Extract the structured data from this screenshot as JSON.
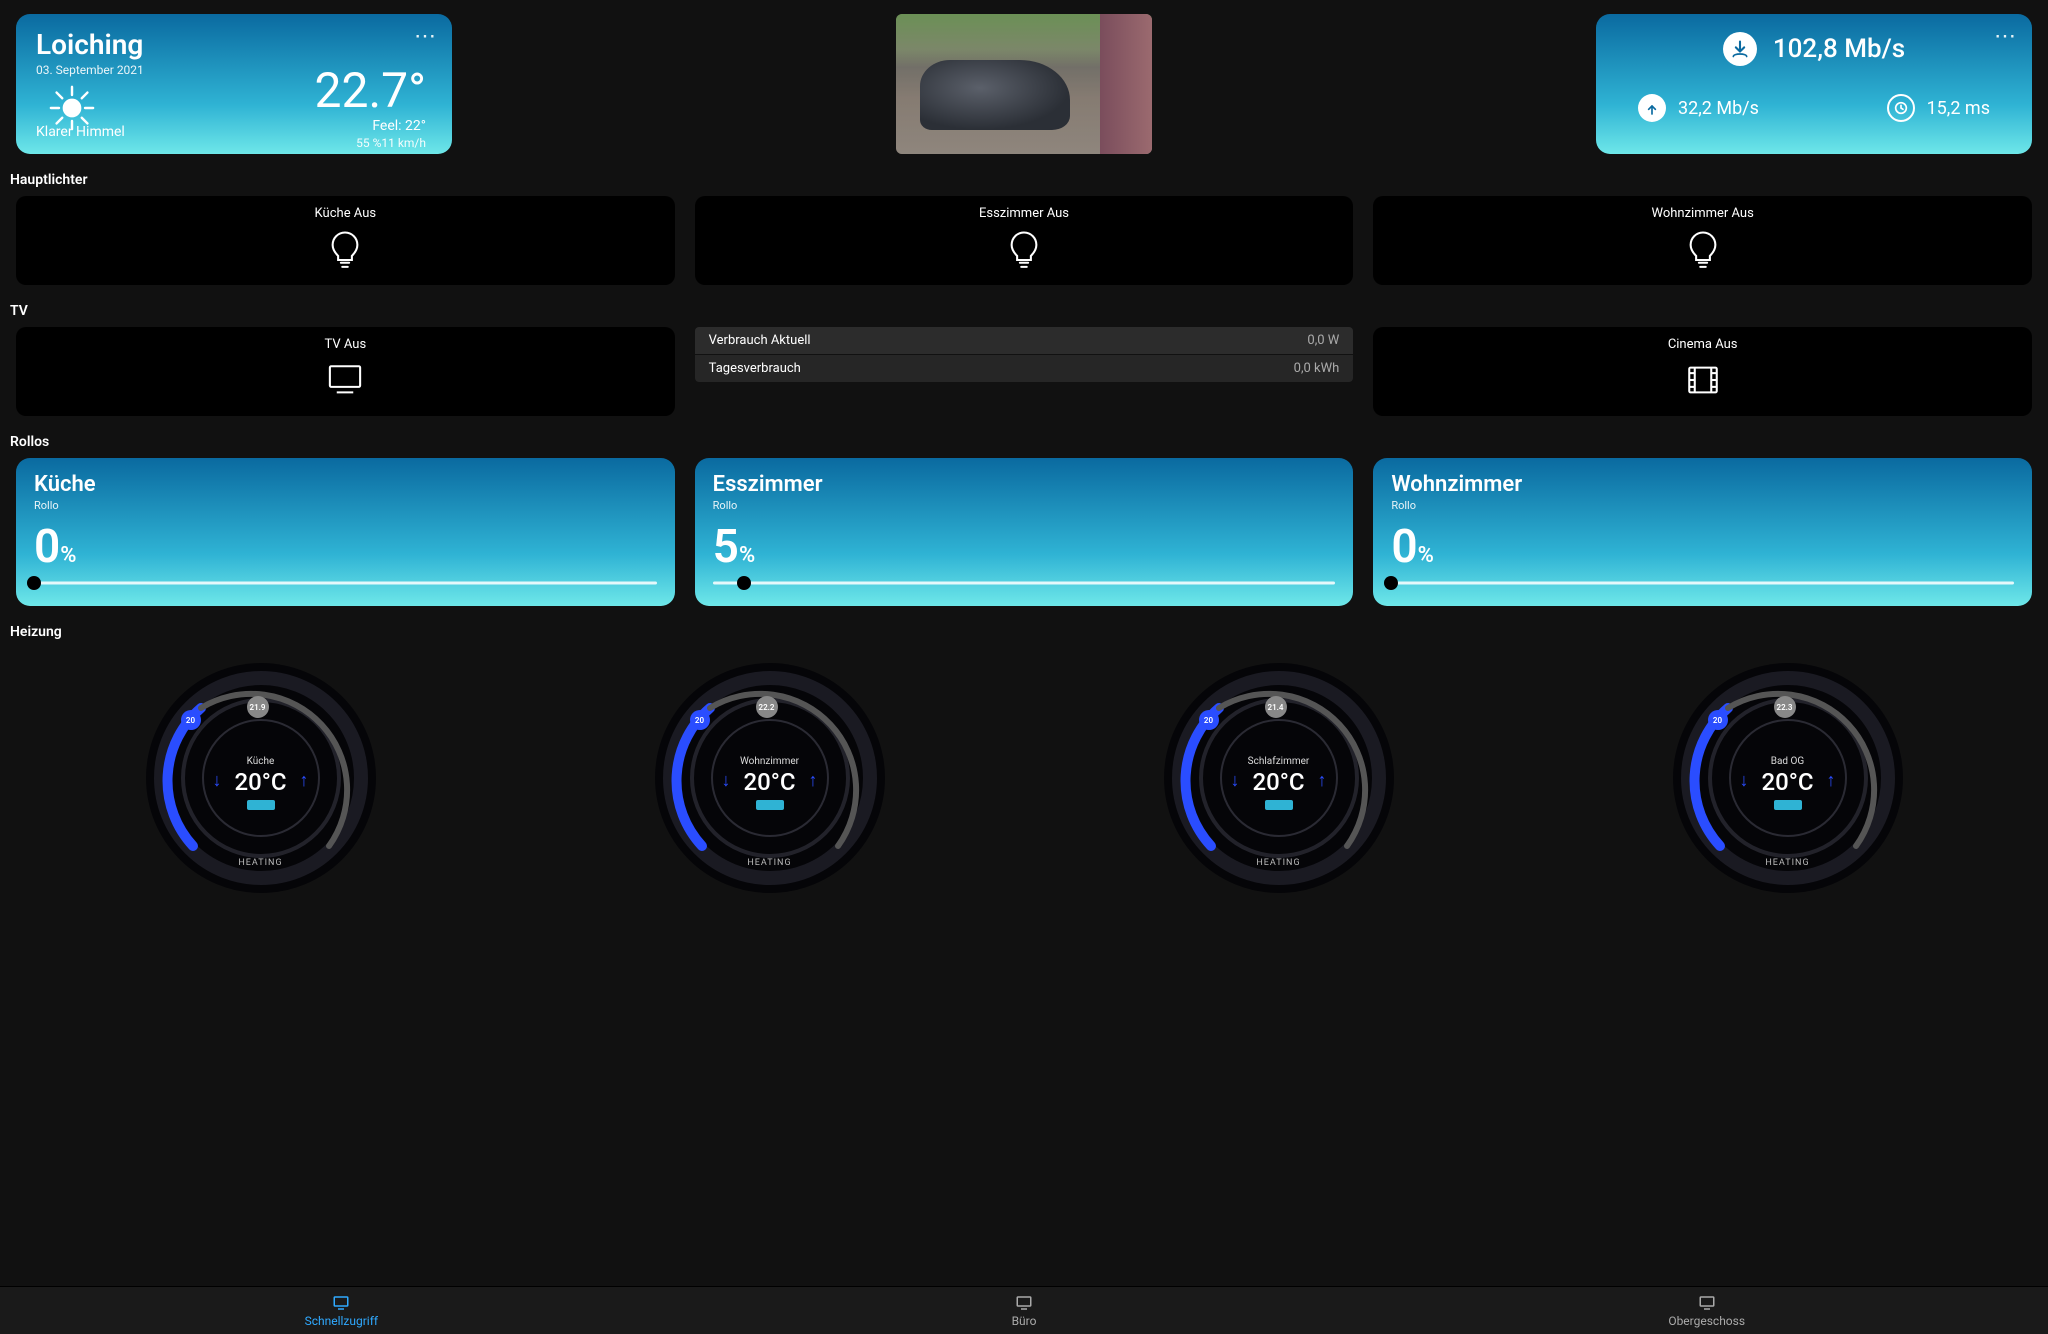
{
  "weather": {
    "location": "Loiching",
    "date": "03. September 2021",
    "condition": "Klarer Himmel",
    "temp": "22.7°",
    "feel": "Feel: 22°",
    "hum_wind": "55 %11 km/h"
  },
  "speed": {
    "down": "102,8 Mb/s",
    "up": "32,2 Mb/s",
    "ping": "15,2 ms"
  },
  "sections": {
    "lights": "Hauptlichter",
    "tv": "TV",
    "rollos": "Rollos",
    "heizung": "Heizung"
  },
  "lights": [
    {
      "label": "Küche Aus"
    },
    {
      "label": "Esszimmer Aus"
    },
    {
      "label": "Wohnzimmer Aus"
    }
  ],
  "tv": {
    "tv_label": "TV Aus",
    "cinema_label": "Cinema Aus",
    "rows": [
      {
        "label": "Verbrauch Aktuell",
        "value": "0,0 W"
      },
      {
        "label": "Tagesverbrauch",
        "value": "0,0 kWh"
      }
    ]
  },
  "rollos": [
    {
      "name": "Küche",
      "sub": "Rollo",
      "pct": "0",
      "pos": 0
    },
    {
      "name": "Esszimmer",
      "sub": "Rollo",
      "pct": "5",
      "pos": 5
    },
    {
      "name": "Wohnzimmer",
      "sub": "Rollo",
      "pct": "0",
      "pos": 0
    }
  ],
  "heizung": [
    {
      "room": "Küche",
      "set": "20°C",
      "mode": "HEATING",
      "badge_set": "20",
      "badge_cur": "21.9"
    },
    {
      "room": "Wohnzimmer",
      "set": "20°C",
      "mode": "HEATING",
      "badge_set": "20",
      "badge_cur": "22.2"
    },
    {
      "room": "Schlafzimmer",
      "set": "20°C",
      "mode": "HEATING",
      "badge_set": "20",
      "badge_cur": "21.4"
    },
    {
      "room": "Bad OG",
      "set": "20°C",
      "mode": "HEATING",
      "badge_set": "20",
      "badge_cur": "22.3"
    }
  ],
  "nav": [
    {
      "label": "Schnellzugriff",
      "active": true
    },
    {
      "label": "Büro",
      "active": false
    },
    {
      "label": "Obergeschoss",
      "active": false
    }
  ],
  "misc": {
    "pct_sign": "%"
  }
}
